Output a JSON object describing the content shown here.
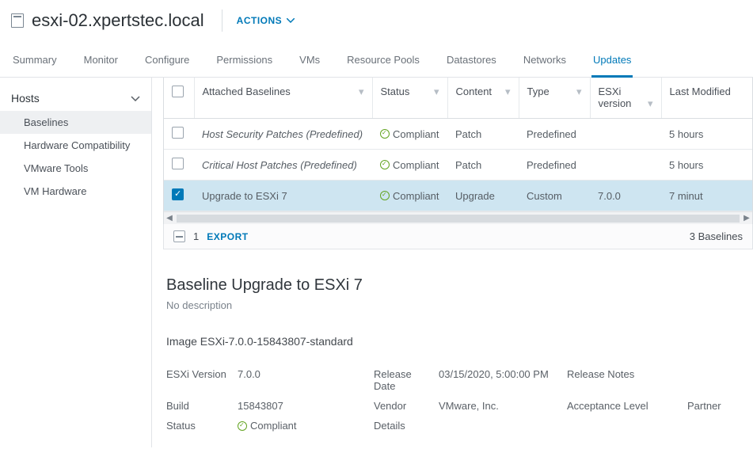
{
  "header": {
    "title": "esxi-02.xpertstec.local",
    "actions": "ACTIONS"
  },
  "tabs": [
    "Summary",
    "Monitor",
    "Configure",
    "Permissions",
    "VMs",
    "Resource Pools",
    "Datastores",
    "Networks",
    "Updates"
  ],
  "active_tab": "Updates",
  "sidebar": {
    "heading": "Hosts",
    "items": [
      "Baselines",
      "Hardware Compatibility",
      "VMware Tools",
      "VM Hardware"
    ],
    "active": "Baselines"
  },
  "table": {
    "columns": {
      "baselines": "Attached Baselines",
      "status": "Status",
      "content": "Content",
      "type": "Type",
      "esxi": "ESXi version",
      "modified": "Last Modified"
    },
    "rows": [
      {
        "name": "Host Security Patches (Predefined)",
        "italic": true,
        "status": "Compliant",
        "content": "Patch",
        "type": "Predefined",
        "esxi": "",
        "modified": "5 hours",
        "checked": false
      },
      {
        "name": "Critical Host Patches (Predefined)",
        "italic": true,
        "status": "Compliant",
        "content": "Patch",
        "type": "Predefined",
        "esxi": "",
        "modified": "5 hours",
        "checked": false
      },
      {
        "name": "Upgrade to ESXi 7",
        "italic": false,
        "status": "Compliant",
        "content": "Upgrade",
        "type": "Custom",
        "esxi": "7.0.0",
        "modified": "7 minut",
        "checked": true
      }
    ],
    "footer": {
      "count": "1",
      "export": "EXPORT",
      "total": "3 Baselines"
    }
  },
  "details": {
    "title": "Baseline Upgrade to ESXi 7",
    "desc": "No description",
    "image": "Image ESXi-7.0.0-15843807-standard",
    "labels": {
      "esxi_ver": "ESXi Version",
      "build": "Build",
      "status": "Status",
      "release": "Release Date",
      "vendor": "Vendor",
      "detailsL": "Details",
      "notes": "Release Notes",
      "accept": "Acceptance Level"
    },
    "values": {
      "esxi_ver": "7.0.0",
      "build": "15843807",
      "status": "Compliant",
      "release": "03/15/2020, 5:00:00 PM",
      "vendor": "VMware, Inc.",
      "accept": "Partner"
    }
  }
}
